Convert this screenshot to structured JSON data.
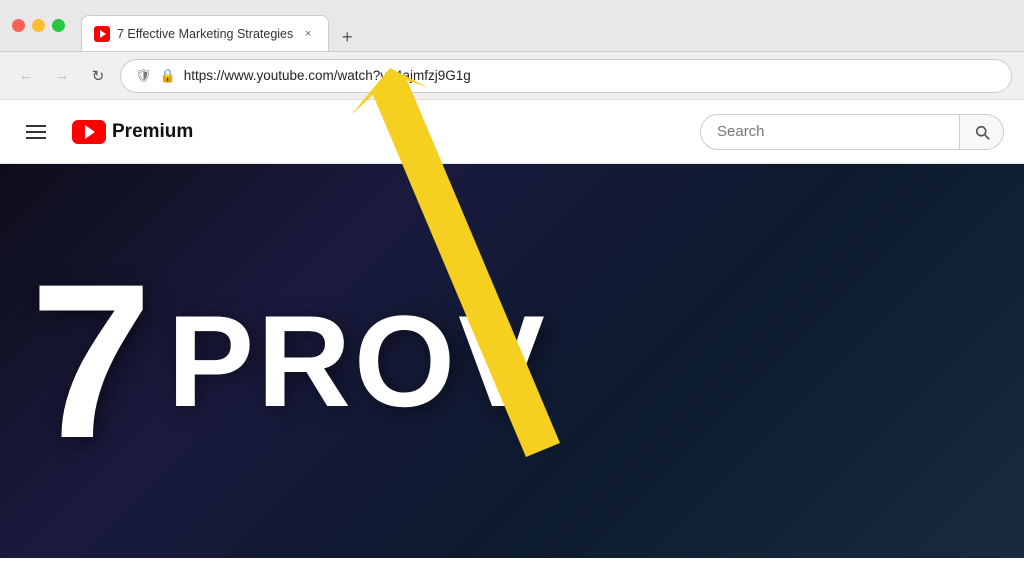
{
  "window": {
    "title": "7 Effective Marketing Strategies",
    "url": "https://www.youtube.com/watch?v=4ajmfzj9G1g",
    "tab_label": "7 Effective Marketing Strategies",
    "close_label": "×",
    "new_tab_label": "+"
  },
  "nav": {
    "back_label": "←",
    "forward_label": "→",
    "refresh_label": "↻",
    "shield_icon": "🛡",
    "lock_icon": "🔒"
  },
  "youtube": {
    "wordmark": "Premium",
    "search_placeholder": "Search",
    "hamburger_label": "Menu"
  },
  "thumbnail": {
    "number": "7",
    "text": "PROV"
  },
  "colors": {
    "close_btn": "#ff5f57",
    "minimize_btn": "#febc2e",
    "maximize_btn": "#28c840",
    "yt_red": "#ff0000",
    "arrow_yellow": "#f5d020"
  }
}
